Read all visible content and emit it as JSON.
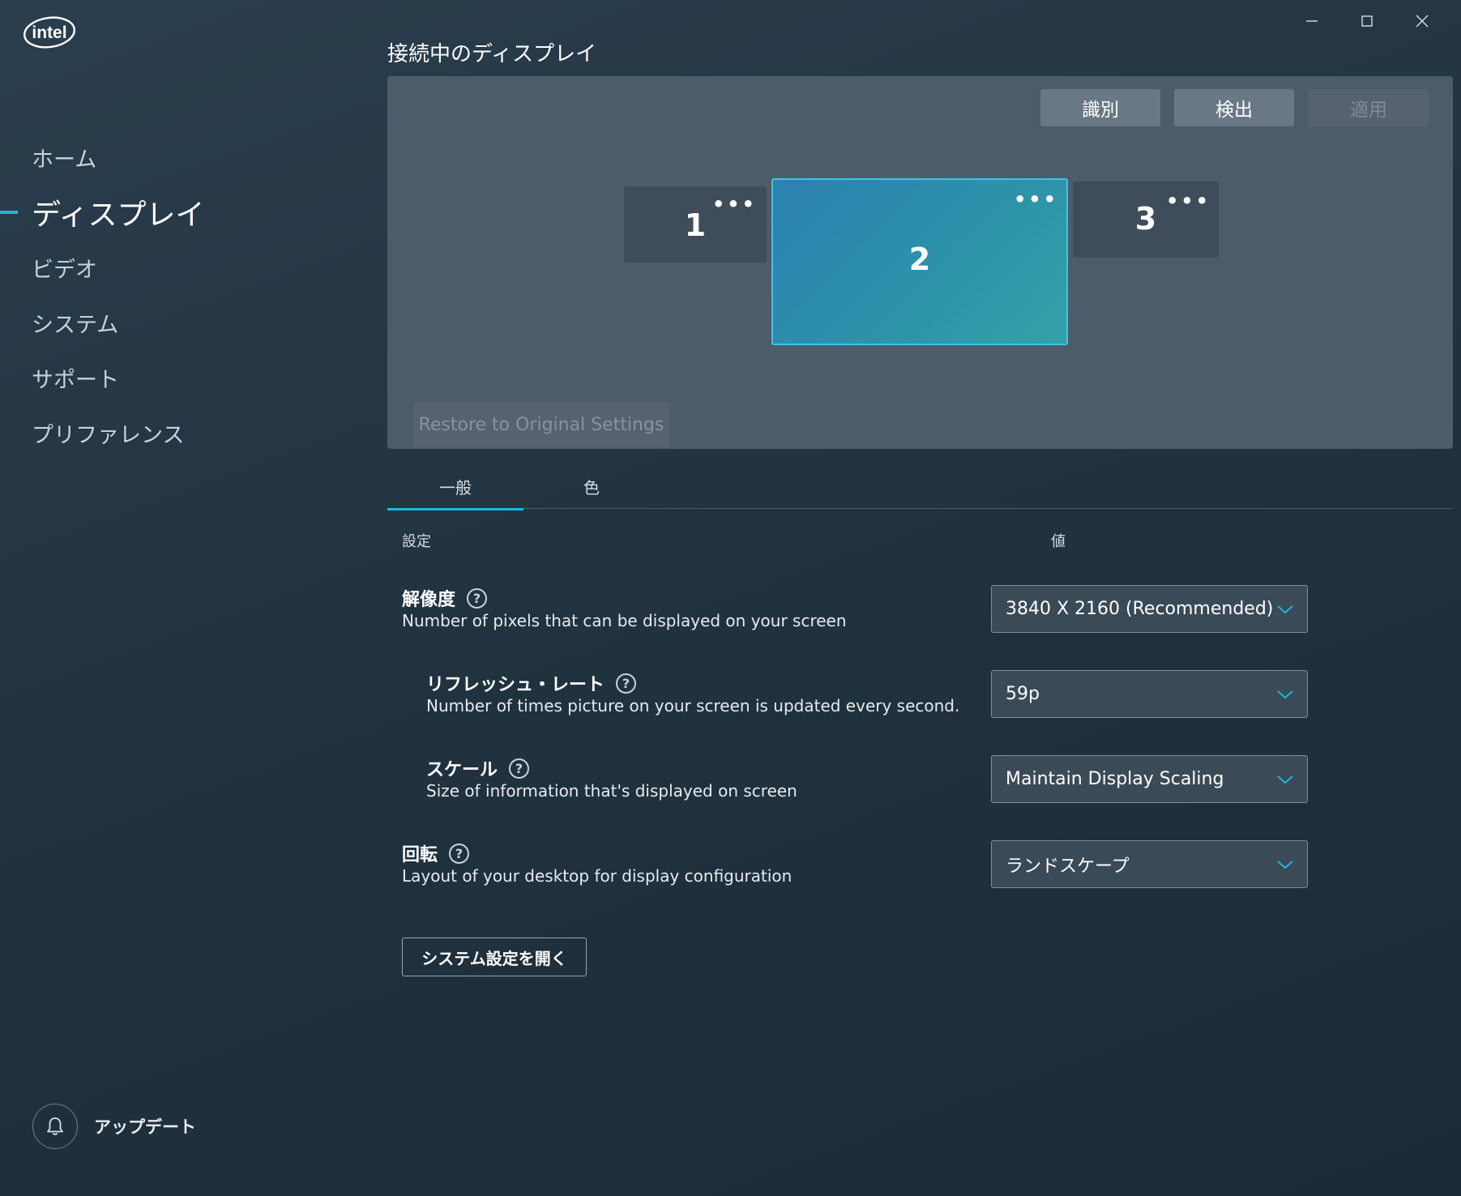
{
  "brand": {
    "logo_text": "intel",
    "accent": "#1fb5e0"
  },
  "sidebar": {
    "items": [
      {
        "label": "ホーム",
        "active": false
      },
      {
        "label": "ディスプレイ",
        "active": true
      },
      {
        "label": "ビデオ",
        "active": false
      },
      {
        "label": "システム",
        "active": false
      },
      {
        "label": "サポート",
        "active": false
      },
      {
        "label": "プリファレンス",
        "active": false
      }
    ],
    "update_label": "アップデート"
  },
  "main": {
    "title": "接続中のディスプレイ",
    "panel": {
      "identify_label": "識別",
      "detect_label": "検出",
      "apply_label": "適用",
      "restore_label": "Restore to Original Settings",
      "monitors": [
        {
          "number": "1",
          "menu": "•••",
          "selected": false
        },
        {
          "number": "2",
          "menu": "•••",
          "selected": true
        },
        {
          "number": "3",
          "menu": "•••",
          "selected": false
        }
      ]
    },
    "tabs": [
      {
        "label": "一般",
        "active": true
      },
      {
        "label": "色",
        "active": false
      }
    ],
    "table": {
      "setting_header": "設定",
      "value_header": "値",
      "help_glyph": "?",
      "rows": [
        {
          "title": "解像度",
          "description": "Number of pixels that can be displayed on your screen",
          "value": "3840 X 2160 (Recommended)"
        },
        {
          "title": "リフレッシュ・レート",
          "description": "Number of times picture on your screen is updated every second.",
          "value": "59p"
        },
        {
          "title": "スケール",
          "description": "Size of information that's displayed on screen",
          "value": "Maintain Display Scaling"
        },
        {
          "title": "回転",
          "description": "Layout of your desktop for display configuration",
          "value": "ランドスケープ"
        }
      ]
    },
    "open_system_settings_label": "システム設定を開く"
  }
}
